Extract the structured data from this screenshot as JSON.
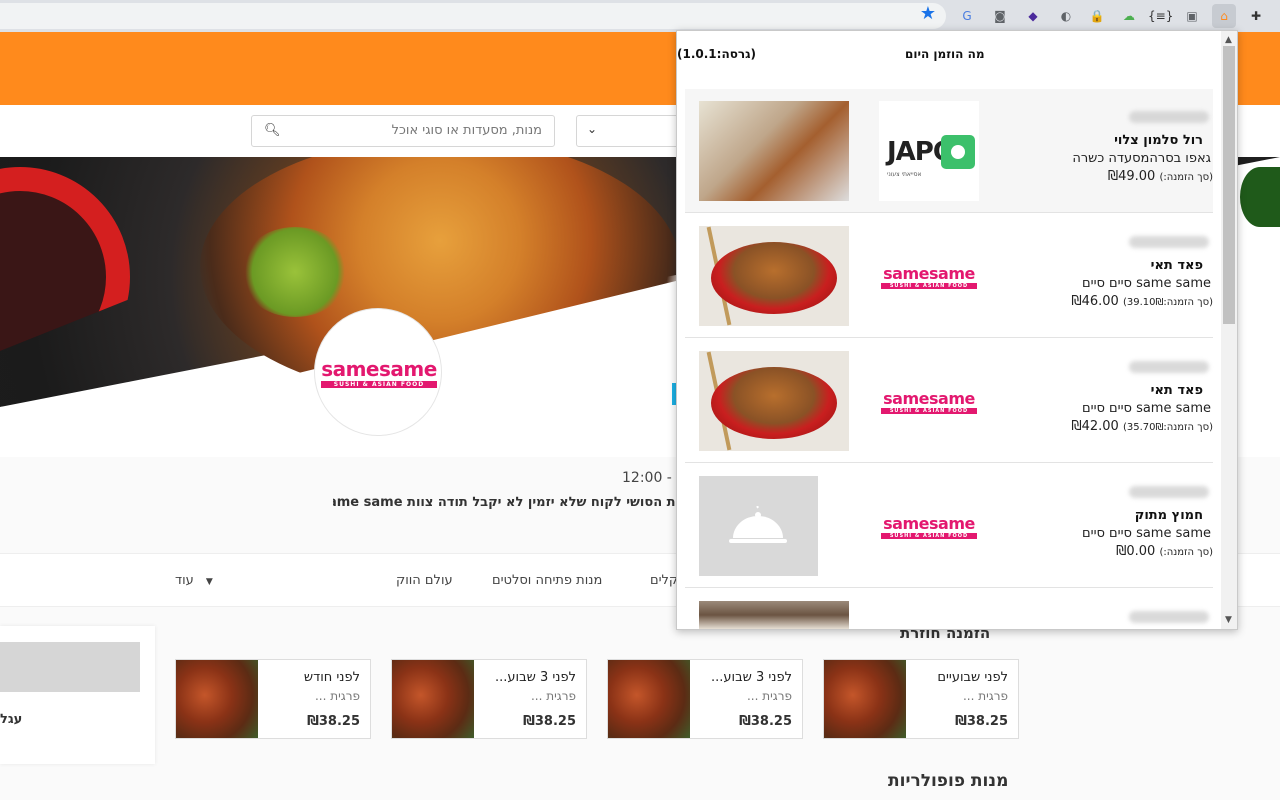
{
  "browser": {
    "extensions": [
      {
        "name": "translate-icon",
        "glyph": "G"
      },
      {
        "name": "mask-icon",
        "glyph": "◙"
      },
      {
        "name": "purple-cube-icon",
        "glyph": "◆"
      },
      {
        "name": "moon-icon",
        "glyph": "◐"
      },
      {
        "name": "lock-icon",
        "glyph": "🔒"
      },
      {
        "name": "cloud-icon",
        "glyph": "☁"
      },
      {
        "name": "json-icon",
        "glyph": "{≡}"
      },
      {
        "name": "window-icon",
        "glyph": "▣"
      },
      {
        "name": "orange-house-icon",
        "glyph": "⌂"
      },
      {
        "name": "puzzle-icon",
        "glyph": "✚"
      }
    ]
  },
  "site": {
    "search_placeholder": "מנות, מסעדות או סוגי אוכל",
    "hours": "12:00 - 2",
    "tagline": "ות הסושי לקוח שלא יזמין לא יקבל תודה צוות same same",
    "brand_logo_text": "samesame",
    "brand_logo_sub": "SUSHI & ASIAN FOOD",
    "categories": [
      {
        "label": "עוד",
        "arrow": "▼"
      },
      {
        "label": "עולם הווק"
      },
      {
        "label": "מנות פתיחה וסלטים"
      },
      {
        "label": "קלים"
      }
    ],
    "recent_orders_title": "הזמנה חוזרת",
    "popular_title": "מנות פופולריות",
    "left_panel_text": "עגל",
    "recent_orders": [
      {
        "when": "לפני שבועיים",
        "what": "פרגית ...",
        "price": "₪38.25"
      },
      {
        "when": "לפני 3 שבוע...",
        "what": "פרגית ...",
        "price": "₪38.25"
      },
      {
        "when": "לפני 3 שבוע...",
        "what": "פרגית ...",
        "price": "₪38.25"
      },
      {
        "when": "לפני חודש",
        "what": "פרגית ...",
        "price": "₪38.25"
      }
    ]
  },
  "popup": {
    "title": "מה הוזמן היום",
    "version": "(גרסה:1.0.1)",
    "japo_logo": "JAPO",
    "japo_logo_sub": "אסייאתי צעוני",
    "entries": [
      {
        "dish": "רול סלמון צלוי",
        "restaurant": "גאפו בסרהמסעדה כשרה",
        "price": "₪49.00",
        "note": "(סך הזמנה:)"
      },
      {
        "dish": "פאד תאי",
        "restaurant": "same same סיים סיים",
        "price": "₪46.00",
        "note": "(סך הזמנה:39.10₪)"
      },
      {
        "dish": "פאד תאי",
        "restaurant": "same same סיים סיים",
        "price": "₪42.00",
        "note": "(סך הזמנה:35.70₪)"
      },
      {
        "dish": "חמוץ מתוק",
        "restaurant": "same same סיים סיים",
        "price": "₪0.00",
        "note": "(סך הזמנה:)"
      }
    ]
  }
}
